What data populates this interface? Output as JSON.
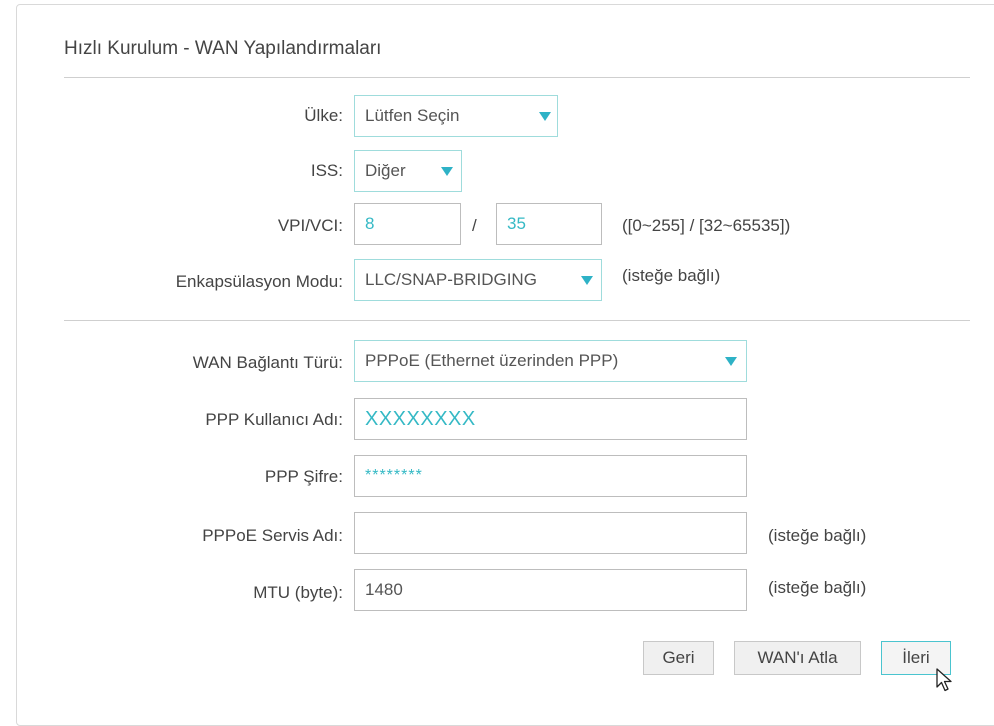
{
  "title": "Hızlı Kurulum - WAN Yapılandırmaları",
  "fields": {
    "country": {
      "label": "Ülke:",
      "value": "Lütfen Seçin"
    },
    "isp": {
      "label": "ISS:",
      "value": "Diğer"
    },
    "vpivci": {
      "label": "VPI/VCI:",
      "vpi": "8",
      "separator": "/",
      "vci": "35",
      "hint": "([0~255] / [32~65535])"
    },
    "encap": {
      "label": "Enkapsülasyon Modu:",
      "value": "LLC/SNAP-BRIDGING",
      "hint": "(isteğe bağlı)"
    },
    "wan_type": {
      "label": "WAN Bağlantı Türü:",
      "value": "PPPoE (Ethernet üzerinden PPP)"
    },
    "ppp_user": {
      "label": "PPP Kullanıcı Adı:",
      "value": "XXXXXXXX"
    },
    "ppp_pass": {
      "label": "PPP Şifre:",
      "value": "********"
    },
    "service": {
      "label": "PPPoE Servis Adı:",
      "value": "",
      "hint": "(isteğe bağlı)"
    },
    "mtu": {
      "label": "MTU (byte):",
      "value": "1480",
      "hint": "(isteğe bağlı)"
    }
  },
  "buttons": {
    "back": "Geri",
    "skip": "WAN'ı Atla",
    "next": "İleri"
  },
  "colors": {
    "accent": "#2eb2c6",
    "select_border": "#9fdcdc",
    "button_focus": "#4ac4cf"
  },
  "icons": {
    "dropdown": "caret-down-icon",
    "cursor": "mouse-pointer-icon"
  }
}
